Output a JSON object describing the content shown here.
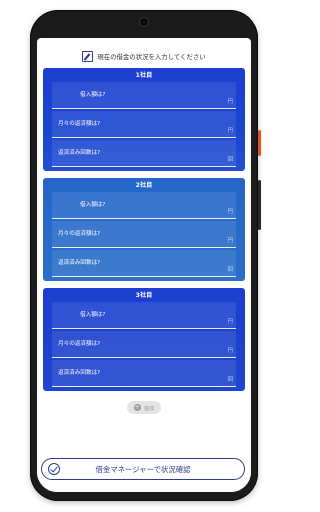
{
  "header": {
    "title": "現在の借金の状況を入力してください",
    "icon": "pencil-square-icon"
  },
  "cards": [
    {
      "title": "1社目",
      "fields": [
        {
          "label": "借入額は?",
          "unit": "円"
        },
        {
          "label": "月々の返済額は?",
          "unit": "円"
        },
        {
          "label": "返済済み回数は?",
          "unit": "回"
        }
      ]
    },
    {
      "title": "2社目",
      "fields": [
        {
          "label": "借入額は?",
          "unit": "円"
        },
        {
          "label": "月々の返済額は?",
          "unit": "円"
        },
        {
          "label": "返済済み回数は?",
          "unit": "回"
        }
      ]
    },
    {
      "title": "3社目",
      "fields": [
        {
          "label": "借入額は?",
          "unit": "円"
        },
        {
          "label": "月々の返済額は?",
          "unit": "円"
        },
        {
          "label": "返済済み回数は?",
          "unit": "回"
        }
      ]
    }
  ],
  "add_button": {
    "label": "追加"
  },
  "confirm_button": {
    "label": "借金マネージャーで状況確認"
  },
  "colors": {
    "card_blue": "#1c3fd0",
    "card_blue_2": "#2566cb",
    "accent_navy": "#2d3b8e",
    "phone_frame": "#1b1b1b",
    "power_button": "#e0522b"
  }
}
